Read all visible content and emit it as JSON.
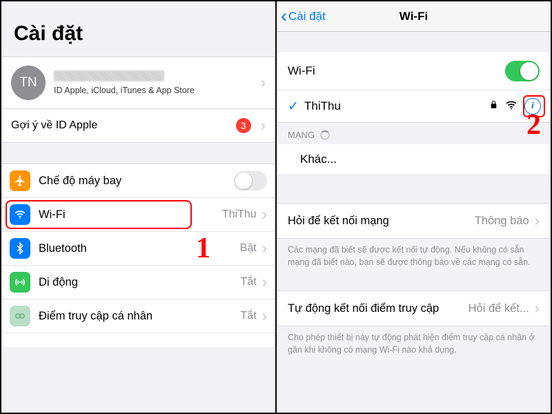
{
  "left": {
    "title": "Cài đặt",
    "account": {
      "initials": "TN",
      "subtitle": "ID Apple, iCloud, iTunes & App Store"
    },
    "suggestion": {
      "label": "Gợi ý về ID Apple",
      "badge": "3"
    },
    "rows": {
      "airplane": {
        "label": "Chế độ máy bay"
      },
      "wifi": {
        "label": "Wi-Fi",
        "value": "ThiThu"
      },
      "bluetooth": {
        "label": "Bluetooth",
        "value": "Bật"
      },
      "cellular": {
        "label": "Di động",
        "value": "Tắt"
      },
      "hotspot": {
        "label": "Điểm truy cập cá nhân",
        "value": "Tắt"
      }
    },
    "annotation_1": "1"
  },
  "right": {
    "back_label": "Cài đặt",
    "nav_title": "Wi-Fi",
    "wifi_toggle_label": "Wi-Fi",
    "connected": {
      "name": "ThiThu"
    },
    "section_networks": "MẠNG",
    "other": "Khác...",
    "ask": {
      "label": "Hỏi để kết nối mạng",
      "value": "Thông báo"
    },
    "ask_footer": "Các mạng đã biết sẽ được kết nối tự động. Nếu không có sẵn mạng đã biết nào, bạn sẽ được thông báo về các mạng có sẵn.",
    "auto": {
      "label": "Tự động kết nối điểm truy cập",
      "value": "Hỏi để kết..."
    },
    "auto_footer": "Cho phép thiết bị này tự động phát hiện điểm truy cập cá nhân ở gần khi không có mạng Wi-Fi nào khả dụng.",
    "annotation_2": "2"
  }
}
